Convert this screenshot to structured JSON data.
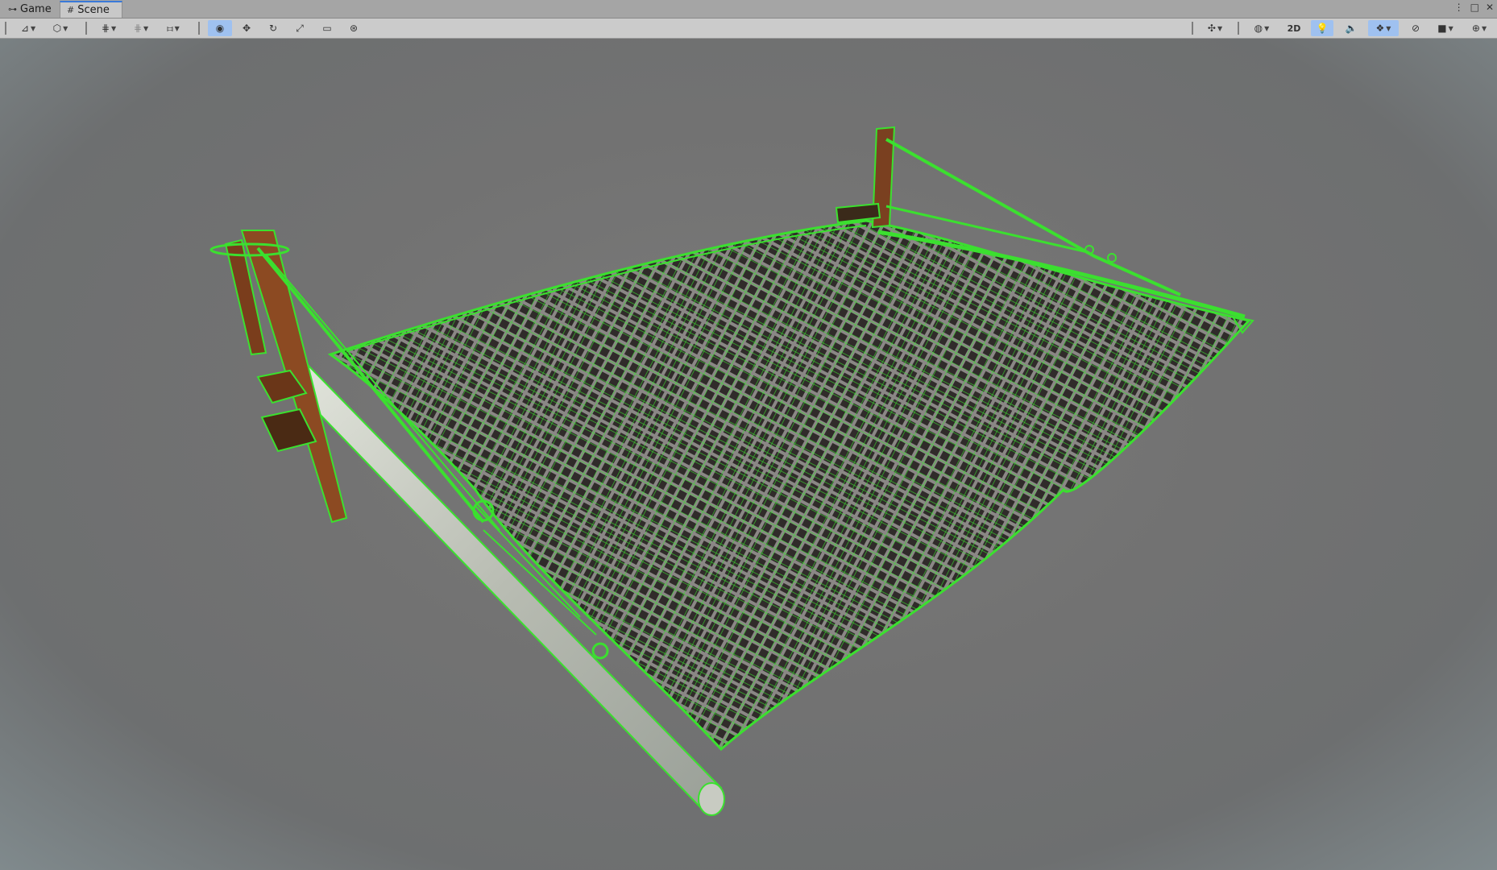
{
  "window": {
    "tabs": [
      {
        "label": "Game",
        "icon": "gamepad-icon"
      },
      {
        "label": "Scene",
        "icon": "grid-icon"
      }
    ],
    "active_tab": "Scene",
    "controls": {
      "menu": "⋮",
      "maximize": "□",
      "close": "✕"
    }
  },
  "toolbar": {
    "left_tools": [
      "draw-mode-icon",
      "shading-icon",
      "grid-snap-icon",
      "snap-increment-icon",
      "align-icon"
    ],
    "transform_tools": [
      "view-tool-icon",
      "move-tool-icon",
      "rotate-tool-icon",
      "scale-tool-icon",
      "rect-tool-icon",
      "transform-tool-icon"
    ],
    "active_tool": "view-tool-icon",
    "right_tools": [
      "gizmo-orientation-icon",
      "global-icon"
    ],
    "mode_2d_label": "2D",
    "toggles": [
      "lighting-icon",
      "audio-icon",
      "effects-icon",
      "visibility-icon",
      "camera-icon",
      "gizmos-icon"
    ],
    "accent_color": "#9fc1f0"
  },
  "scene": {
    "object": "hammock",
    "wireframe_color": "#34e02a",
    "post_color": "#8c4a22",
    "net_color": "#3a3533",
    "pole_color": "#c9cdc4"
  }
}
